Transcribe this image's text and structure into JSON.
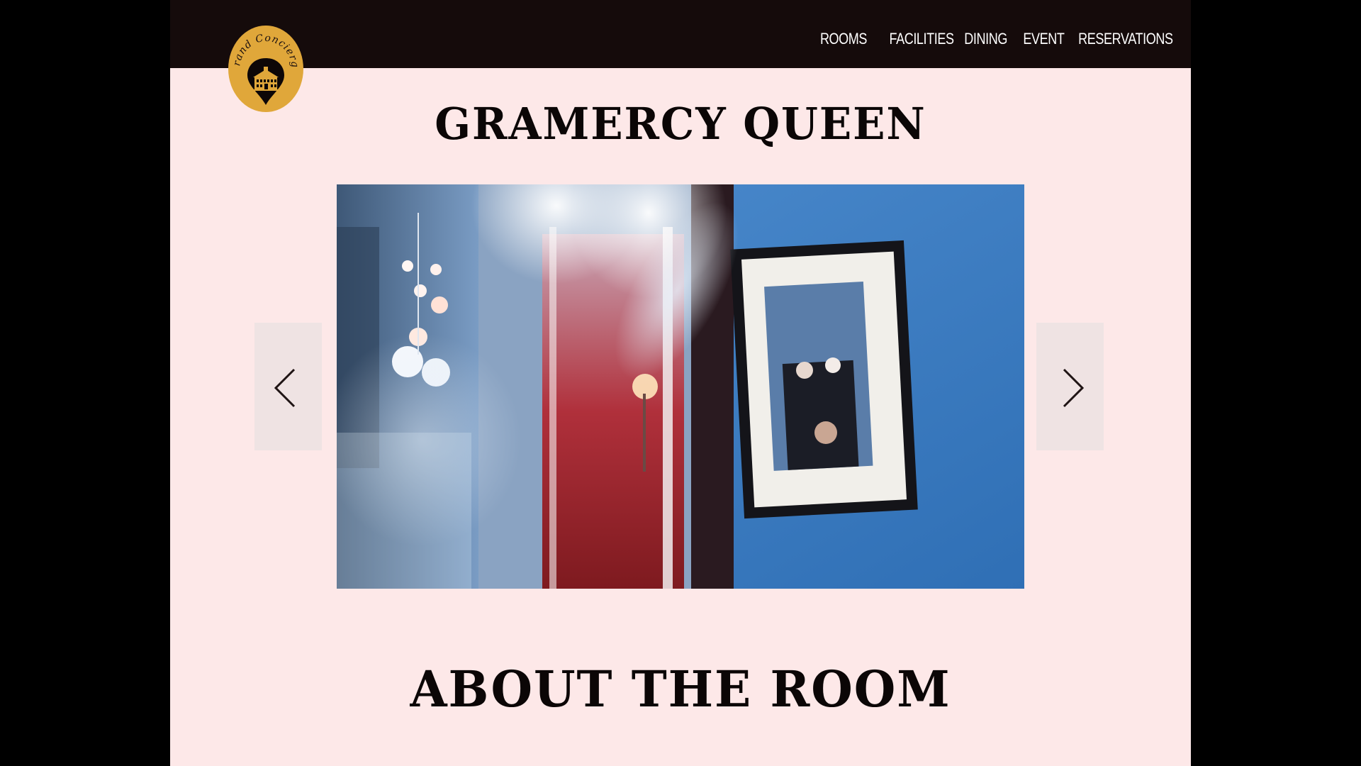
{
  "nav": {
    "items": [
      {
        "label": "ROOMS"
      },
      {
        "label": "FACILITIES"
      },
      {
        "label": "DINING"
      },
      {
        "label": "EVENT"
      },
      {
        "label": "RESERVATIONS"
      }
    ]
  },
  "logo": {
    "text": "Grand Concierge",
    "background_color": "#e0a73a",
    "icon": "hotel-building-icon"
  },
  "room": {
    "title": "GRAMERCY QUEEN"
  },
  "carousel": {
    "prev_icon": "chevron-left-icon",
    "next_icon": "chevron-right-icon"
  },
  "about": {
    "heading": "ABOUT THE ROOM"
  },
  "colors": {
    "header": "#150b0b",
    "page_background": "#fde8e8",
    "outer_background": "#000000",
    "heading_text": "#0b0606"
  }
}
